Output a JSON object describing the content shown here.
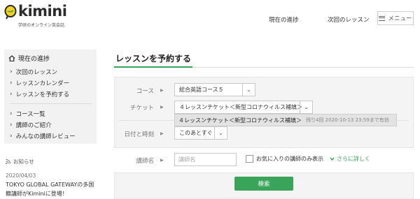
{
  "header": {
    "logo_text": "kimini",
    "logo_subtitle": "学研のオンライン英会話",
    "nav": [
      "現在の進捗",
      "次回のレッスン"
    ],
    "menu_label": "メニュー"
  },
  "sidebar": {
    "title": "現在の進捗",
    "group1": [
      "次回のレッスン",
      "レッスンカレンダー",
      "レッスンを予約する"
    ],
    "group2": [
      "コース一覧",
      "講師のご紹介",
      "みんなの講師レビュー"
    ]
  },
  "news": {
    "heading": "お知らせ",
    "date": "2020/04/03",
    "text": "TOKYO GLOBAL GATEWAYの多国籍講師がKiminiに登場！"
  },
  "main": {
    "title": "レッスンを予約する",
    "course_label": "コース",
    "course_value": "総合英語コース５",
    "ticket_label": "チケット",
    "ticket_value": "４レッスンチケット＜新型コロナウィルス補填＞",
    "dropdown_option": "４レッスンチケット＜新型コロナウィルス補填＞",
    "dropdown_note": "残り4回  2020-10-13 23:59まで有効",
    "datetime_label": "日付と時刻",
    "datetime_value": "このあとすぐ",
    "teacher_label": "講師名",
    "teacher_placeholder": "講師名",
    "favorites_label": "お気に入りの講師のみ表示",
    "more_label": "さらに詳しく",
    "search_label": "検索"
  },
  "colors": {
    "accent": "#3aa55a",
    "logo_yellow": "#f2d21b"
  }
}
